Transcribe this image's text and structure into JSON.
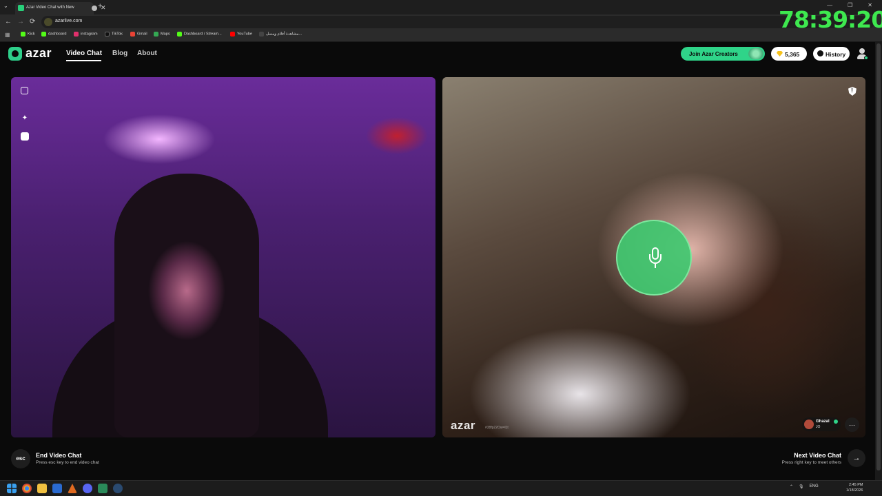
{
  "browser": {
    "tab_title": "Azar Video Chat with New",
    "tab_close": "✕",
    "new_tab": "+",
    "tab_menu": "⌄",
    "window_controls": [
      "—",
      "❐",
      "✕"
    ],
    "nav": {
      "back": "←",
      "forward": "→",
      "reload": "⟳"
    },
    "url": "azarlive.com",
    "bookmarks": [
      {
        "label": "Kick",
        "color": "#53fc18"
      },
      {
        "label": "dashboard",
        "color": "#53fc18"
      },
      {
        "label": "instagram",
        "color": "#e1306c"
      },
      {
        "label": "TikTok",
        "color": "#111111"
      },
      {
        "label": "Gmail",
        "color": "#ea4335"
      },
      {
        "label": "Maps",
        "color": "#34a853"
      },
      {
        "label": "Dashboard / Stream...",
        "color": "#53fc18"
      },
      {
        "label": "YouTube",
        "color": "#ff0000"
      },
      {
        "label": "مشاهدة أفلام ومسل...",
        "color": "#444444"
      }
    ]
  },
  "overlay_timer": "78:39:20",
  "site": {
    "logo": "azar",
    "nav": {
      "video_chat": "Video Chat",
      "blog": "Blog",
      "about": "About"
    },
    "join_creators": "Join Azar Creators",
    "coins": "5,365",
    "history": "History"
  },
  "local_panel": {
    "icons": [
      "fullscreen-icon",
      "magic-wand-icon",
      "sticker-icon"
    ]
  },
  "remote_panel": {
    "watermark": "azar",
    "watermark_sub": "#38fp22Ow=l1t",
    "peer_name": "Ghazal",
    "peer_country": "JO",
    "mic_state": "mic-icon",
    "chat_glyph": "…"
  },
  "controls": {
    "esc_key": "esc",
    "end_title": "End Video Chat",
    "end_subtitle": "Press esc key to end video chat",
    "next_title": "Next Video Chat",
    "next_subtitle": "Press right key to meet others",
    "next_arrow": "→"
  },
  "taskbar": {
    "tray": [
      "⌃",
      "ENG"
    ],
    "time": "2:45 PM",
    "date": "1/18/2026"
  },
  "colors": {
    "accent": "#2fd489",
    "timer": "#3ee84f"
  }
}
